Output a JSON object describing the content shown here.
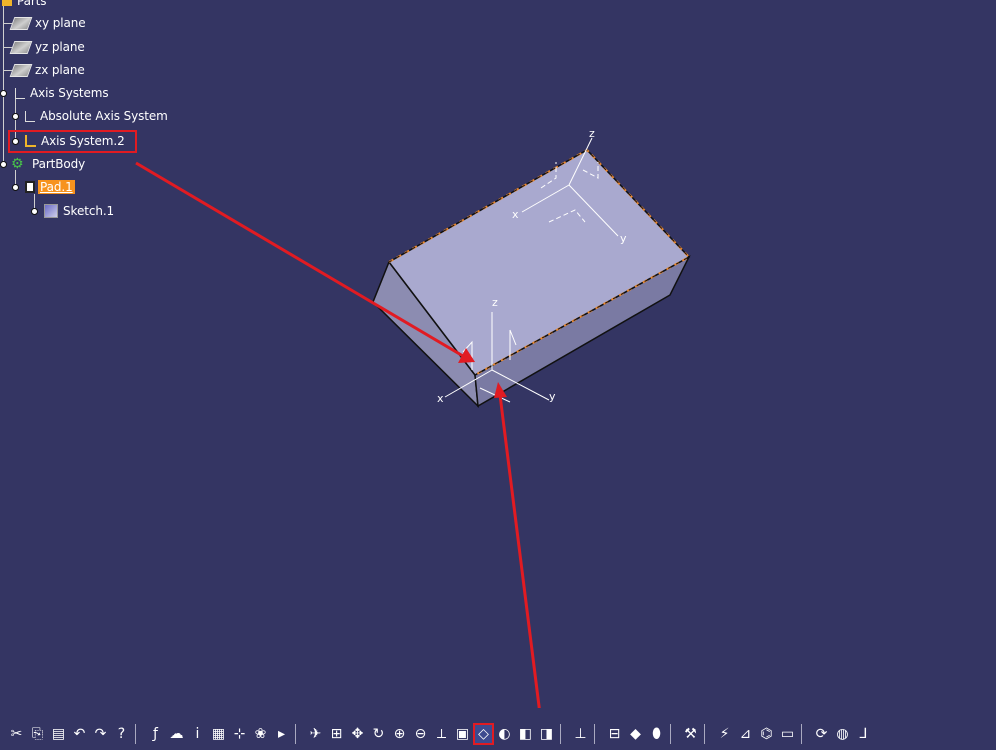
{
  "spec_tree": {
    "root_label": "Parts",
    "planes": [
      "xy plane",
      "yz plane",
      "zx plane"
    ],
    "axis_systems_label": "Axis Systems",
    "absolute_axis_label": "Absolute Axis System",
    "axis_system2_label": "Axis System.2",
    "partbody_label": "PartBody",
    "pad_label": "Pad.1",
    "sketch_label": "Sketch.1"
  },
  "viewport": {
    "background": "#343563",
    "solid_top_color": "#a9a9cf",
    "solid_side_color": "#8c8cb1",
    "edge_highlight_color": "#e8862e",
    "annotation_color": "#e11b22",
    "top_axis_labels": {
      "z": "z",
      "x": "x",
      "y": "y"
    },
    "corner_axis_labels": {
      "z": "z",
      "x": "x",
      "y": "y"
    }
  },
  "toolbar": {
    "groups": [
      [
        "cut-icon",
        "copy-icon",
        "paste-icon",
        "undo-icon",
        "redo-icon",
        "whats-this-icon"
      ],
      [
        "formula-icon",
        "comment-icon",
        "hint-icon",
        "table-icon",
        "tree-icon",
        "catalog-icon",
        "expand-icon"
      ],
      [
        "fly-icon",
        "fit-all-icon",
        "pan-icon",
        "rotate-icon",
        "zoom-in-icon",
        "zoom-out-icon",
        "normal-view-icon",
        "multi-view-icon",
        "isometric-view-icon",
        "shading-icon",
        "hide-show-icon",
        "swap-icon"
      ],
      [
        "measure-icon"
      ],
      [
        "section-icon",
        "render-icon",
        "material-icon"
      ],
      [
        "wrench-icon"
      ],
      [
        "analysis-icon",
        "constraint-icon",
        "knowledge-icon",
        "eraser-icon"
      ],
      [
        "refresh-icon",
        "sphere-icon",
        "axis-icon"
      ]
    ],
    "glyphs": {
      "cut-icon": "✂",
      "copy-icon": "⎘",
      "paste-icon": "▤",
      "undo-icon": "↶",
      "redo-icon": "↷",
      "whats-this-icon": "?",
      "formula-icon": "ƒ",
      "comment-icon": "☁",
      "hint-icon": "ⅰ",
      "table-icon": "▦",
      "tree-icon": "⊹",
      "catalog-icon": "❀",
      "expand-icon": "▸",
      "fly-icon": "✈",
      "fit-all-icon": "⊞",
      "pan-icon": "✥",
      "rotate-icon": "↻",
      "zoom-in-icon": "⊕",
      "zoom-out-icon": "⊖",
      "normal-view-icon": "⟂",
      "multi-view-icon": "▣",
      "isometric-view-icon": "◇",
      "shading-icon": "◐",
      "hide-show-icon": "◧",
      "swap-icon": "◨",
      "measure-icon": "⊥",
      "section-icon": "⊟",
      "render-icon": "◆",
      "material-icon": "⬮",
      "wrench-icon": "⚒",
      "analysis-icon": "⚡",
      "constraint-icon": "⊿",
      "knowledge-icon": "⌬",
      "eraser-icon": "▭",
      "refresh-icon": "⟳",
      "sphere-icon": "◍",
      "axis-icon": "⅃"
    },
    "active": "isometric-view-icon"
  }
}
